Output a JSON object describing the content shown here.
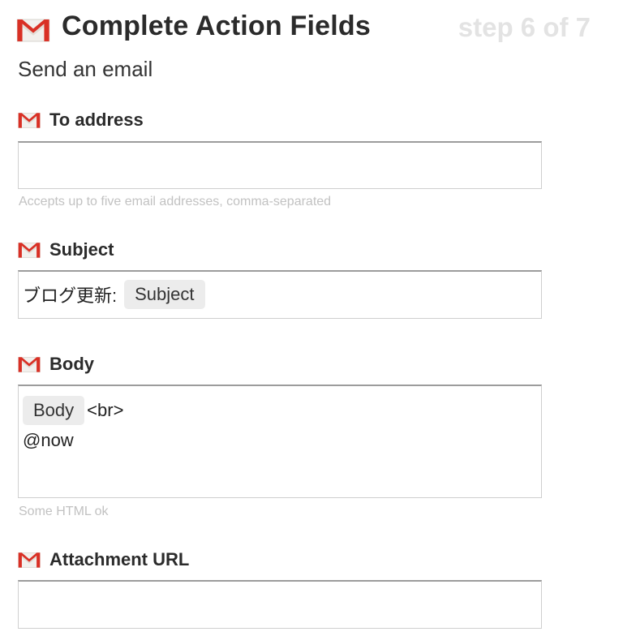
{
  "header": {
    "title": "Complete Action Fields",
    "step": "step 6 of 7"
  },
  "action": {
    "subtitle": "Send an email"
  },
  "fields": {
    "to_address": {
      "label": "To address",
      "value": "",
      "helper": "Accepts up to five email addresses, comma-separated"
    },
    "subject": {
      "label": "Subject",
      "prefix_text": "ブログ更新:",
      "ingredient": "Subject"
    },
    "body": {
      "label": "Body",
      "ingredient": "Body",
      "after_ingredient": "<br>",
      "line2": "@now",
      "helper": "Some HTML ok"
    },
    "attachment_url": {
      "label": "Attachment URL",
      "value": ""
    }
  },
  "icons": {
    "service_icon": "gmail-icon"
  },
  "colors": {
    "gmail_red": "#d93025",
    "step_gray": "#e3e3e3",
    "helper_gray": "#c2c2c2",
    "pill_bg": "#ececec"
  }
}
